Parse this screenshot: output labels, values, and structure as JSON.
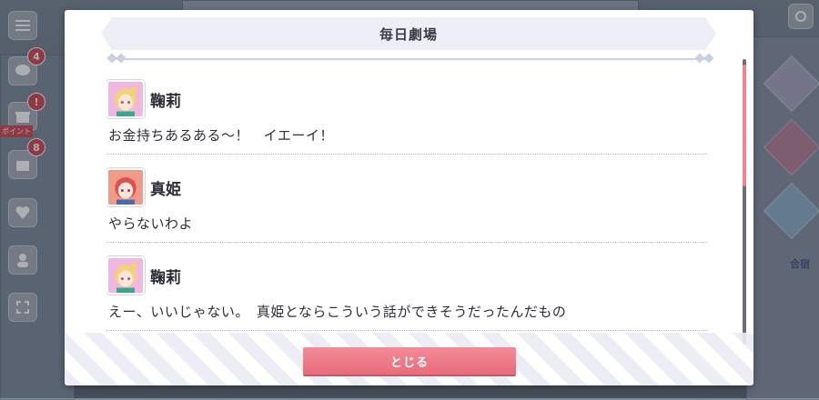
{
  "background": {
    "badges": [
      "4",
      "8"
    ],
    "side_label": "ポイント",
    "right_label": "合宿"
  },
  "modal": {
    "title": "毎日劇場",
    "close_label": "とじる",
    "entries": [
      {
        "speaker": "鞠莉",
        "avatar": "mari-avatar",
        "text": "お金持ちあるある～！　イエーイ！"
      },
      {
        "speaker": "真姫",
        "avatar": "maki-avatar",
        "text": "やらないわよ"
      },
      {
        "speaker": "鞠莉",
        "avatar": "mari-avatar",
        "text": "えー、いいじゃない。　真姫とならこういう話ができそうだったんだもの"
      }
    ]
  },
  "colors": {
    "accent": "#ee8591",
    "button": "#e96b7c",
    "text": "#2e2e38",
    "header_bg": "#eeeff6",
    "mari_hair": "#f4d27a",
    "maki_hair": "#d9534f"
  }
}
